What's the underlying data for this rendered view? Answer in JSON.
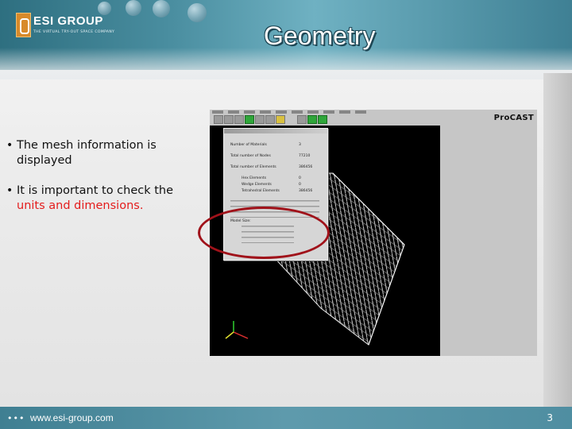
{
  "slide": {
    "title": "Geometry",
    "logo": {
      "name": "ESI GROUP",
      "tagline": "THE VIRTUAL TRY-OUT SPACE COMPANY"
    },
    "bullets": [
      {
        "text": "The mesh information is displayed"
      },
      {
        "prefix": "It is important to check the ",
        "highlight": "units and dimensions."
      }
    ],
    "footer": {
      "url": "www.esi-group.com",
      "page_number": "3"
    }
  },
  "screenshot": {
    "app_name": "ProCAST",
    "mesh_info": {
      "rows": [
        {
          "label": "Number of Materials",
          "value": "3"
        },
        {
          "label": "Total number of Nodes",
          "value": "77210"
        },
        {
          "label": "Total number of Elements",
          "value": "386456"
        },
        {
          "label": "Hex Elements",
          "value": "0"
        },
        {
          "label": "Wedge Elements",
          "value": "0"
        },
        {
          "label": "Tetrahedral Elements",
          "value": "386456"
        }
      ],
      "model_size_heading": "Model Size:"
    }
  },
  "colors": {
    "accent": "#4a8ea0",
    "highlight_text": "#e41c1c",
    "annotation_circle": "#a0121a"
  }
}
